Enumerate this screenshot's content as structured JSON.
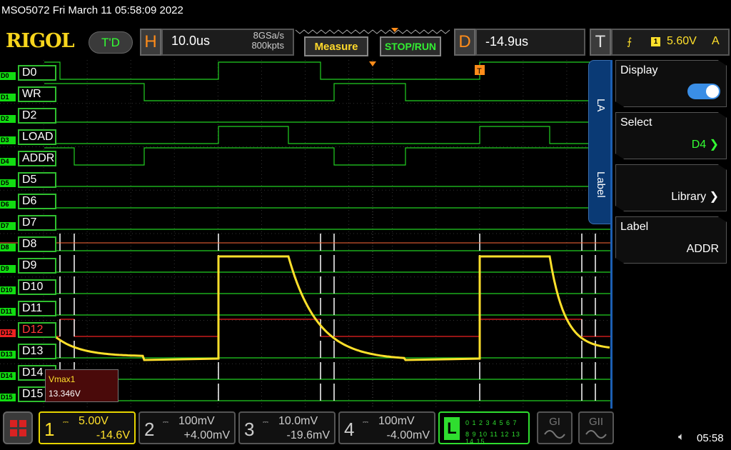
{
  "title": "MSO5072  Fri March 11 05:58:09 2022",
  "header": {
    "logo": "RIGOL",
    "td_button": "T'D",
    "horizontal": {
      "letter": "H",
      "timebase": "10.0us",
      "sample_rate": "8GSa/s",
      "memory_depth": "800kpts"
    },
    "measure_button": "Measure",
    "run_button": "STOP/RUN",
    "delay": {
      "letter": "D",
      "value": "-14.9us"
    },
    "trigger": {
      "letter": "T",
      "source": "1",
      "level": "5.60V",
      "mode": "A"
    }
  },
  "digital_channels": [
    {
      "tag": "D0",
      "label": "D0"
    },
    {
      "tag": "D1",
      "label": "WR"
    },
    {
      "tag": "D2",
      "label": "D2"
    },
    {
      "tag": "D3",
      "label": "LOAD"
    },
    {
      "tag": "D4",
      "label": "ADDR"
    },
    {
      "tag": "D5",
      "label": "D5"
    },
    {
      "tag": "D6",
      "label": "D6"
    },
    {
      "tag": "D7",
      "label": "D7"
    },
    {
      "tag": "D8",
      "label": "D8"
    },
    {
      "tag": "D9",
      "label": "D9"
    },
    {
      "tag": "D10",
      "label": "D10"
    },
    {
      "tag": "D11",
      "label": "D11"
    },
    {
      "tag": "D12",
      "label": "D12"
    },
    {
      "tag": "D13",
      "label": "D13"
    },
    {
      "tag": "D14",
      "label": "D14"
    },
    {
      "tag": "D15",
      "label": "D15"
    }
  ],
  "measurement": {
    "name": "Vmax1",
    "value": "13.346V"
  },
  "side_panel": {
    "tabs": [
      "LA",
      "Label"
    ],
    "display": {
      "title": "Display",
      "enabled": true
    },
    "select": {
      "title": "Select",
      "value": "D4"
    },
    "library": {
      "title": "Library"
    },
    "label": {
      "title": "Label",
      "value": "ADDR"
    }
  },
  "analog_channels": [
    {
      "num": "1",
      "scale": "5.00V",
      "offset": "-14.6V",
      "active": true
    },
    {
      "num": "2",
      "scale": "100mV",
      "offset": "+4.00mV",
      "active": false
    },
    {
      "num": "3",
      "scale": "10.0mV",
      "offset": "-19.6mV",
      "active": false
    },
    {
      "num": "4",
      "scale": "100mV",
      "offset": "-4.00mV",
      "active": false
    }
  ],
  "la_button": {
    "letter": "L",
    "row1": "0 1 2 3  4 5 6 7",
    "row2": "8 9 10 11 12 13 14 15"
  },
  "generators": [
    "GI",
    "GII"
  ],
  "clock": "05:58",
  "colors": {
    "ch1": "#ffe02b",
    "digital": "#22d022",
    "d12": "#ee2222",
    "accent": "#1c5fb3"
  }
}
